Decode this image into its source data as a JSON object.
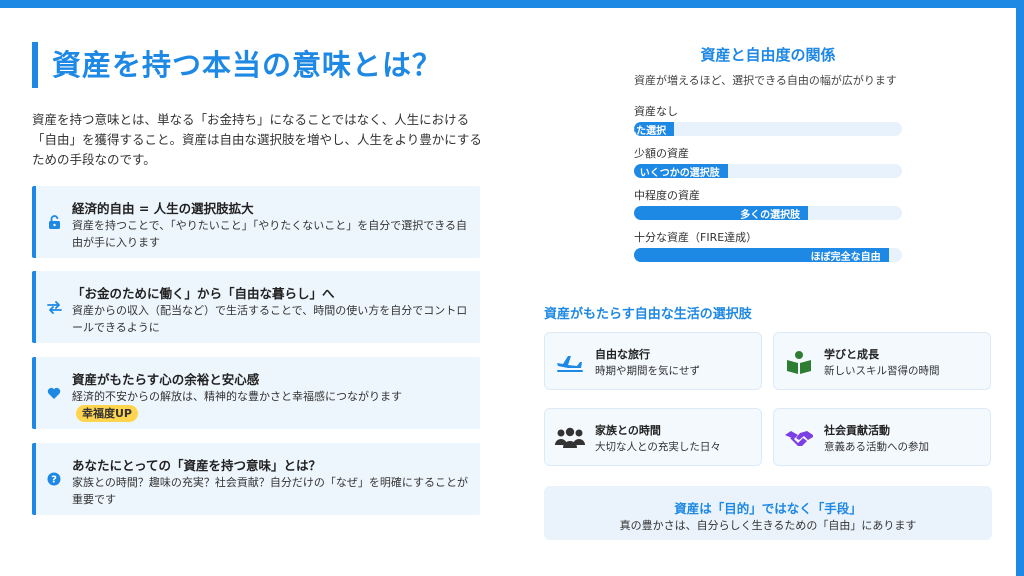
{
  "colors": {
    "accent": "#1e88e5",
    "card_bg": "#eef6fd",
    "badge_bg": "#ffd54f",
    "bar_track": "#e8f2fc"
  },
  "page": {
    "title": "資産を持つ本当の意味とは？",
    "intro": "資産を持つ意味とは、単なる「お金持ち」になることではなく、人生における「自由」を獲得すること。資産は自由な選択肢を増やし、人生をより豊かにするための手段なのです。"
  },
  "cards": [
    {
      "icon": "unlock-icon",
      "title": "経済的自由 = 人生の選択肢拡大",
      "desc": "資産を持つことで、「やりたいこと」「やりたくないこと」を自分で選択できる自由が手に入ります"
    },
    {
      "icon": "exchange-arrows-icon",
      "title": "「お金のために働く」から「自由な暮らし」へ",
      "desc": "資産からの収入（配当など）で生活することで、時間の使い方を自分でコントロールできるように"
    },
    {
      "icon": "heart-icon",
      "title": "資産がもたらす心の余裕と安心感",
      "desc": "経済的不安からの解放は、精神的な豊かさと幸福感につながります",
      "badge": "幸福度UP"
    },
    {
      "icon": "question-circle-icon",
      "title": "あなたにとっての「資産を持つ意味」とは？",
      "desc": "家族との時間？趣味の充実？社会貢献？自分だけの「なぜ」を明確にすることが重要です"
    }
  ],
  "chart_data": {
    "type": "bar",
    "title": "資産と自由度の関係",
    "subtitle": "資産が増えるほど、選択できる自由の幅が広がります",
    "categories": [
      "資産なし",
      "少額の資産",
      "中程度の資産",
      "十分な資産（FIRE達成）"
    ],
    "values": [
      15,
      35,
      65,
      95
    ],
    "value_labels": [
      "限られた選択",
      "いくつかの選択肢",
      "多くの選択肢",
      "ほぼ完全な自由"
    ],
    "ylim": [
      0,
      100
    ]
  },
  "options": {
    "title": "資産がもたらす自由な生活の選択肢",
    "items": [
      {
        "icon": "airplane-icon",
        "title": "自由な旅行",
        "desc": "時期や期間を気にせず"
      },
      {
        "icon": "book-icon",
        "title": "学びと成長",
        "desc": "新しいスキル習得の時間"
      },
      {
        "icon": "people-icon",
        "title": "家族との時間",
        "desc": "大切な人との充実した日々"
      },
      {
        "icon": "handshake-icon",
        "title": "社会貢献活動",
        "desc": "意義ある活動への参加"
      }
    ]
  },
  "key_point": {
    "title": "資産は「目的」ではなく「手段」",
    "desc": "真の豊かさは、自分らしく生きるための「自由」にあります"
  }
}
